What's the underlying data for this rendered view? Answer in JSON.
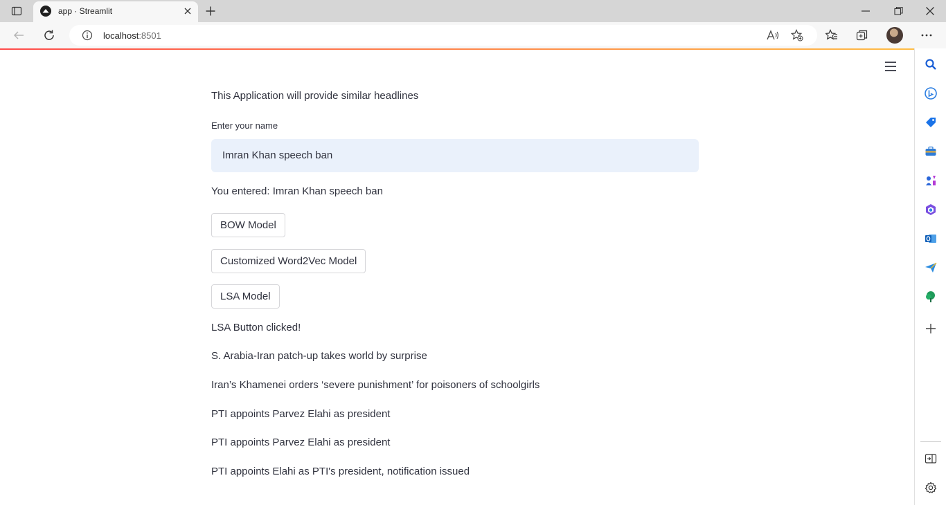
{
  "browser": {
    "tab_title": "app · Streamlit",
    "url_host": "localhost",
    "url_port": ":8501"
  },
  "app": {
    "intro_text": "This Application will provide similar headlines",
    "input_label": "Enter your name",
    "input_value": "Imran Khan speech ban",
    "entered_text": "You entered: Imran Khan speech ban",
    "buttons": {
      "bow": "BOW Model",
      "word2vec": "Customized Word2Vec Model",
      "lsa": "LSA Model"
    },
    "status_text": "LSA Button clicked!",
    "results": [
      "S. Arabia-Iran patch-up takes world by surprise",
      "Iran’s Khamenei orders ‘severe punishment’ for poisoners of schoolgirls",
      "PTI appoints Parvez Elahi as president",
      "PTI appoints Parvez Elahi as president",
      "PTI appoints Elahi as PTI's president, notification issued"
    ]
  },
  "colors": {
    "accent_start": "#ff4b4b",
    "accent_end": "#ffbd45",
    "input_bg": "#eaf1fb",
    "text": "#31333f"
  },
  "icons": [
    "tab-actions-icon",
    "streamlit-favicon",
    "close-icon",
    "plus-icon",
    "minimize-icon",
    "restore-icon",
    "window-close-icon",
    "back-icon",
    "refresh-icon",
    "info-icon",
    "read-aloud-icon",
    "add-favorite-icon",
    "favorites-icon",
    "collections-icon",
    "more-icon",
    "hamburger-icon",
    "search-icon",
    "bing-icon",
    "shopping-icon",
    "tools-icon",
    "games-icon",
    "office-icon",
    "outlook-icon",
    "send-icon",
    "tree-icon",
    "add-icon",
    "split-screen-icon",
    "settings-icon"
  ]
}
